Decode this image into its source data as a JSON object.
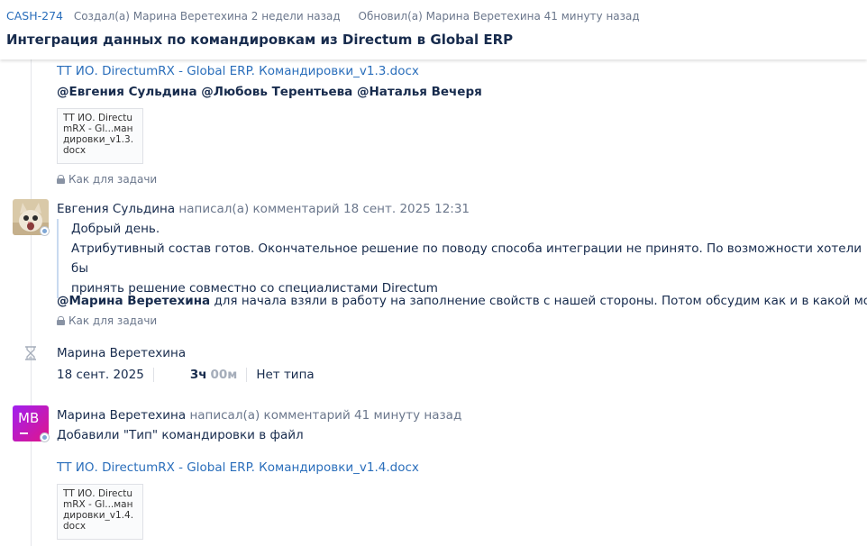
{
  "header": {
    "issue_key": "CASH-274",
    "created": "Создал(а) Марина Веретехина 2 недели назад",
    "updated": "Обновил(а) Марина Веретехина 41 минуту назад",
    "title": "Интеграция данных по командировкам из Directum в Global ERP"
  },
  "entry1": {
    "attachment_link": "ТТ ИО. DirectumRX - Global ERP. Командировки_v1.3.docx",
    "mentions": "@Евгения Сульдина @Любовь Терентьева @Наталья Вечеря",
    "thumb_lines": [
      "ТТ ИО. Directu",
      "mRX - Gl...ман",
      "дировки_v1.3.",
      "docx"
    ],
    "visibility": "Как для задачи"
  },
  "comment2": {
    "author": "Евгения Сульдина",
    "action": "написал(а) комментарий 18 сент. 2025 12:31",
    "quote_lines": [
      "Добрый день.",
      "Атрибутивный состав готов. Окончательное решение по поводу способа интеграции не принято. По возможности хотели бы",
      "принять решение совместно со специалистами Directum"
    ],
    "reply_mention": "@Марина Веретехина",
    "reply_text": " для начала взяли в работу на заполнение свойств с нашей стороны. Потом обсудим как и в какой момент",
    "visibility": "Как для задачи"
  },
  "worklog": {
    "icon": "hourglass-icon",
    "author": "Марина Веретехина",
    "date": "18 сент. 2025",
    "hours": "3ч",
    "minutes": "00м",
    "type": "Нет типа"
  },
  "comment3": {
    "avatar_initials": "МВ",
    "author": "Марина Веретехина",
    "action": "написал(а) комментарий 41 минуту назад",
    "text": "Добавили \"Тип\" командировки в файл",
    "attachment_link": "ТТ ИО. DirectumRX - Global ERP. Командировки_v1.4.docx",
    "thumb_lines": [
      "ТТ ИО. Directu",
      "mRX - Gl...ман",
      "дировки_v1.4.",
      "docx"
    ]
  },
  "colors": {
    "link": "#2a6ebb",
    "muted": "#6b778c",
    "avatar_gradient_start": "#a020f0",
    "avatar_gradient_end": "#e0158a"
  }
}
